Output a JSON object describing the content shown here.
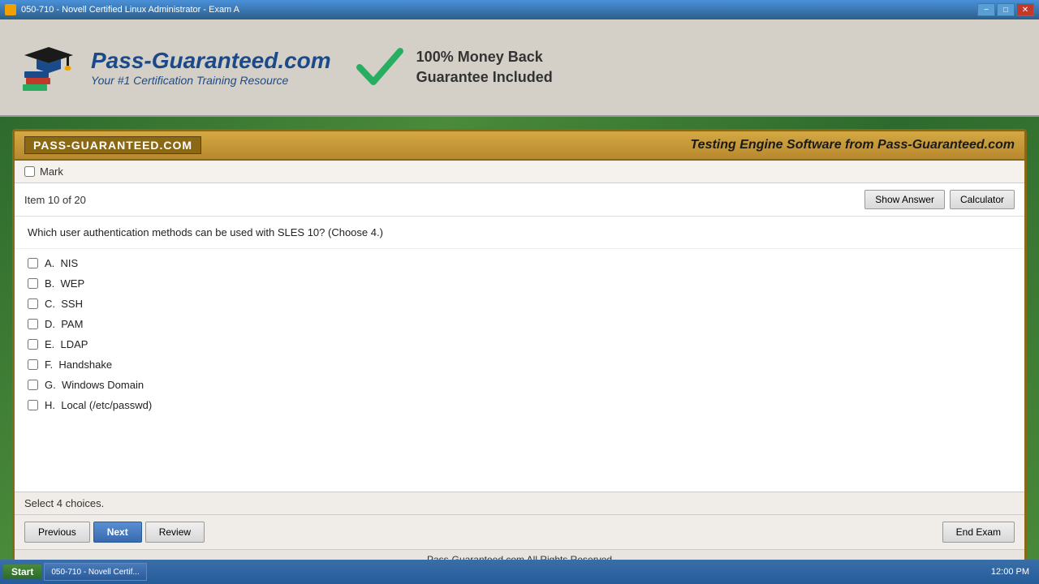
{
  "titlebar": {
    "title": "050-710 - Novell Certified Linux Administrator - Exam A",
    "min_label": "−",
    "max_label": "□",
    "close_label": "✕"
  },
  "header": {
    "logo_brand": "Pass-Guaranteed.com",
    "logo_tagline": "Your #1 Certification Training Resource",
    "guarantee_line1": "100% Money Back",
    "guarantee_line2": "Guarantee Included"
  },
  "panel": {
    "logo_text": "PASS-GUARANTEED.COM",
    "panel_title": "Testing Engine Software from Pass-Guaranteed.com",
    "mark_label": "Mark",
    "item_counter": "Item 10 of 20",
    "show_answer_label": "Show Answer",
    "calculator_label": "Calculator",
    "question_text": "Which user authentication methods can be used with SLES 10? (Choose 4.)",
    "choices": [
      {
        "id": "A",
        "text": "NIS"
      },
      {
        "id": "B",
        "text": "WEP"
      },
      {
        "id": "C",
        "text": "SSH"
      },
      {
        "id": "D",
        "text": "PAM"
      },
      {
        "id": "E",
        "text": "LDAP"
      },
      {
        "id": "F",
        "text": "Handshake"
      },
      {
        "id": "G",
        "text": "Windows Domain"
      },
      {
        "id": "H",
        "text": "Local (/etc/passwd)"
      }
    ],
    "select_info": "Select 4 choices.",
    "previous_label": "Previous",
    "next_label": "Next",
    "review_label": "Review",
    "end_exam_label": "End Exam",
    "copyright": "Pass-Guaranteed.com All Rights Reserved"
  },
  "taskbar": {
    "start_label": "Start",
    "items": [
      "050-710 - Novell Certif..."
    ]
  }
}
